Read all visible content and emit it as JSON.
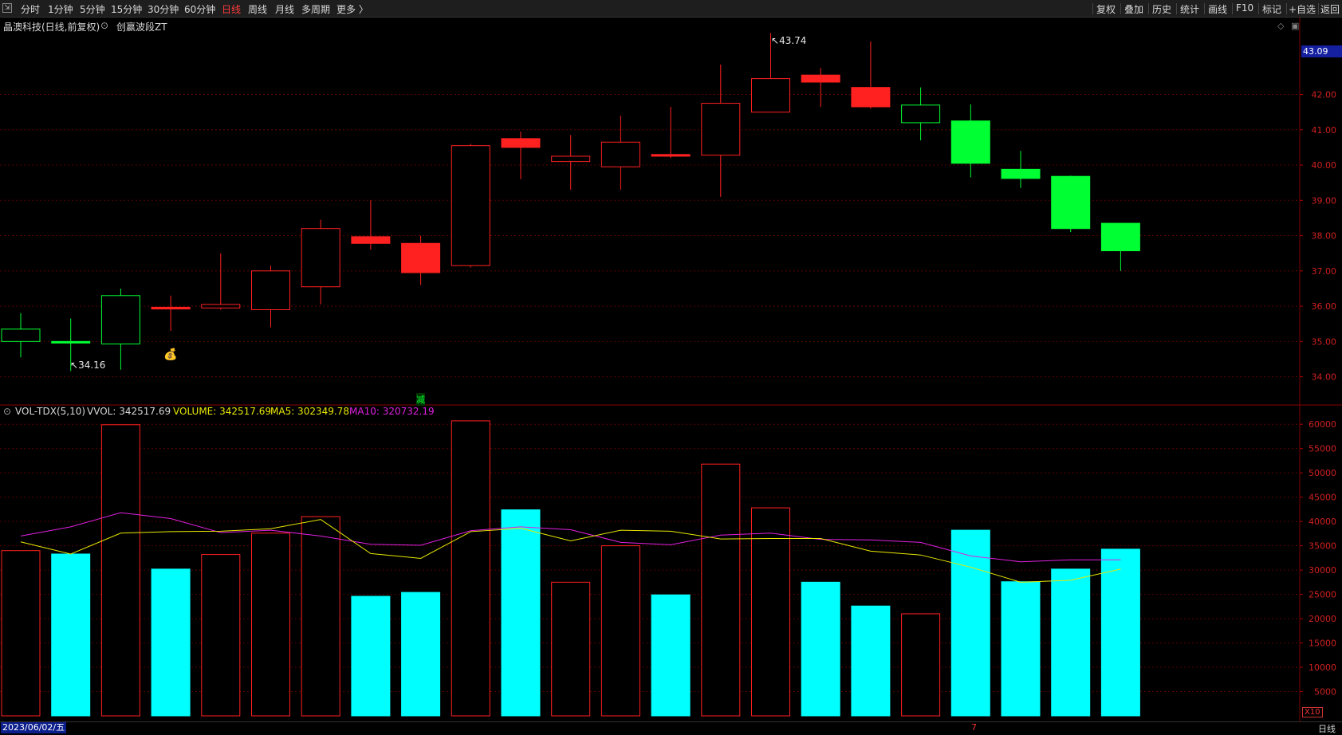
{
  "toolbar": {
    "left_items": [
      "分时",
      "1分钟",
      "5分钟",
      "15分钟",
      "30分钟",
      "60分钟",
      "日线",
      "周线",
      "月线",
      "多周期",
      "更多 〉"
    ],
    "active_item": "日线",
    "right_items": [
      "复权",
      "叠加",
      "历史",
      "统计",
      "画线",
      "F10",
      "标记",
      "+自选",
      "返回"
    ]
  },
  "header": {
    "stock_name": "晶澳科技(日线,前复权)",
    "indicator_name": "创赢波段ZT",
    "current_price": "43.09"
  },
  "volume_panel": {
    "title": "VOL-TDX(5,10)",
    "vvol": "VVOL: 342517.69",
    "volume": "VOLUME: 342517.69",
    "ma5": "MA5: 302349.78",
    "ma10": "MA10: 320732.19",
    "multiplier": "X10"
  },
  "footer": {
    "date": "2023/06/02/五",
    "period": "日线",
    "marker": "7"
  },
  "annotations": {
    "high_label": "43.74",
    "low_label": "34.16",
    "reduce_marker": "减",
    "money_icon": "money-bag-icon"
  },
  "colors": {
    "up": "#ff2020",
    "down": "#00ff33",
    "vol_down": "#00ffff",
    "ma5": "#e8e800",
    "ma10": "#e020e0",
    "grid": "#5a0000"
  },
  "chart_data": [
    {
      "type": "candlestick",
      "y_axis_ticks": [
        "34.00",
        "35.00",
        "36.00",
        "37.00",
        "38.00",
        "39.00",
        "40.00",
        "41.00",
        "42.00"
      ],
      "ylim": [
        33.2,
        44.0
      ],
      "candles": [
        {
          "open": 35.35,
          "high": 35.8,
          "low": 34.55,
          "close": 35.0,
          "dir": "down",
          "style": "hollow"
        },
        {
          "open": 35.0,
          "high": 35.65,
          "low": 34.16,
          "close": 34.97,
          "dir": "down",
          "style": "filled"
        },
        {
          "open": 34.93,
          "high": 36.5,
          "low": 34.2,
          "close": 36.3,
          "dir": "down",
          "style": "hollow"
        },
        {
          "open": 35.92,
          "high": 36.3,
          "low": 35.3,
          "close": 35.97,
          "dir": "up",
          "style": "filled"
        },
        {
          "open": 35.95,
          "high": 37.5,
          "low": 35.9,
          "close": 36.05,
          "dir": "up",
          "style": "hollow"
        },
        {
          "open": 35.9,
          "high": 37.15,
          "low": 35.4,
          "close": 37.0,
          "dir": "up",
          "style": "hollow"
        },
        {
          "open": 36.55,
          "high": 38.45,
          "low": 36.05,
          "close": 38.2,
          "dir": "up",
          "style": "hollow"
        },
        {
          "open": 37.97,
          "high": 39.0,
          "low": 37.6,
          "close": 37.78,
          "dir": "up",
          "style": "filled"
        },
        {
          "open": 37.78,
          "high": 38.0,
          "low": 36.6,
          "close": 36.95,
          "dir": "up",
          "style": "filled"
        },
        {
          "open": 37.15,
          "high": 40.6,
          "low": 37.1,
          "close": 40.55,
          "dir": "up",
          "style": "hollow"
        },
        {
          "open": 40.75,
          "high": 40.95,
          "low": 39.6,
          "close": 40.5,
          "dir": "up",
          "style": "filled"
        },
        {
          "open": 40.25,
          "high": 40.85,
          "low": 39.3,
          "close": 40.1,
          "dir": "up",
          "style": "hollow"
        },
        {
          "open": 39.95,
          "high": 41.4,
          "low": 39.3,
          "close": 40.65,
          "dir": "up",
          "style": "hollow"
        },
        {
          "open": 40.3,
          "high": 41.65,
          "low": 40.2,
          "close": 40.25,
          "dir": "up",
          "style": "filled"
        },
        {
          "open": 40.28,
          "high": 42.85,
          "low": 39.1,
          "close": 41.75,
          "dir": "up",
          "style": "hollow"
        },
        {
          "open": 41.5,
          "high": 43.74,
          "low": 41.5,
          "close": 42.45,
          "dir": "up",
          "style": "hollow"
        },
        {
          "open": 42.55,
          "high": 42.75,
          "low": 41.65,
          "close": 42.35,
          "dir": "up",
          "style": "filled"
        },
        {
          "open": 42.2,
          "high": 43.5,
          "low": 41.6,
          "close": 41.65,
          "dir": "up",
          "style": "filled"
        },
        {
          "open": 41.7,
          "high": 42.2,
          "low": 40.7,
          "close": 41.2,
          "dir": "down",
          "style": "hollow"
        },
        {
          "open": 41.25,
          "high": 41.72,
          "low": 39.65,
          "close": 40.05,
          "dir": "down",
          "style": "filled"
        },
        {
          "open": 39.88,
          "high": 40.4,
          "low": 39.35,
          "close": 39.62,
          "dir": "down",
          "style": "filled"
        },
        {
          "open": 39.68,
          "high": 39.7,
          "low": 38.1,
          "close": 38.2,
          "dir": "down",
          "style": "filled"
        },
        {
          "open": 38.35,
          "high": 38.35,
          "low": 37.0,
          "close": 37.57,
          "dir": "down",
          "style": "filled"
        }
      ]
    },
    {
      "type": "bar",
      "y_axis_ticks": [
        "5000",
        "10000",
        "15000",
        "20000",
        "25000",
        "30000",
        "35000",
        "40000",
        "45000",
        "50000",
        "55000",
        "60000"
      ],
      "ylim": [
        0,
        62000
      ],
      "volumes": [
        {
          "value": 34000,
          "style": "hollow-red"
        },
        {
          "value": 33300,
          "style": "filled-cyan"
        },
        {
          "value": 59900,
          "style": "hollow-red"
        },
        {
          "value": 30200,
          "style": "filled-cyan"
        },
        {
          "value": 33200,
          "style": "hollow-red"
        },
        {
          "value": 37600,
          "style": "hollow-red"
        },
        {
          "value": 41000,
          "style": "hollow-red"
        },
        {
          "value": 24600,
          "style": "filled-cyan"
        },
        {
          "value": 25400,
          "style": "filled-cyan"
        },
        {
          "value": 60700,
          "style": "hollow-red"
        },
        {
          "value": 42400,
          "style": "filled-cyan"
        },
        {
          "value": 27500,
          "style": "hollow-red"
        },
        {
          "value": 35000,
          "style": "hollow-red"
        },
        {
          "value": 24900,
          "style": "filled-cyan"
        },
        {
          "value": 51800,
          "style": "hollow-red"
        },
        {
          "value": 42800,
          "style": "hollow-red"
        },
        {
          "value": 27500,
          "style": "filled-cyan"
        },
        {
          "value": 22600,
          "style": "filled-cyan"
        },
        {
          "value": 21000,
          "style": "hollow-red"
        },
        {
          "value": 38200,
          "style": "filled-cyan"
        },
        {
          "value": 27600,
          "style": "filled-cyan"
        },
        {
          "value": 30200,
          "style": "filled-cyan"
        },
        {
          "value": 34300,
          "style": "filled-cyan"
        }
      ],
      "ma5": [
        35800,
        33300,
        37600,
        37900,
        38000,
        38500,
        40400,
        33400,
        32400,
        37900,
        38600,
        36000,
        38200,
        38000,
        36400,
        36500,
        36500,
        33900,
        33100,
        30600,
        27500,
        27900,
        30200
      ],
      "ma10": [
        37000,
        38900,
        41800,
        40600,
        37700,
        38200,
        37000,
        35300,
        35100,
        38100,
        38900,
        38300,
        35700,
        35200,
        37200,
        37600,
        36300,
        36200,
        35700,
        32900,
        31700,
        32100,
        32100
      ]
    }
  ]
}
